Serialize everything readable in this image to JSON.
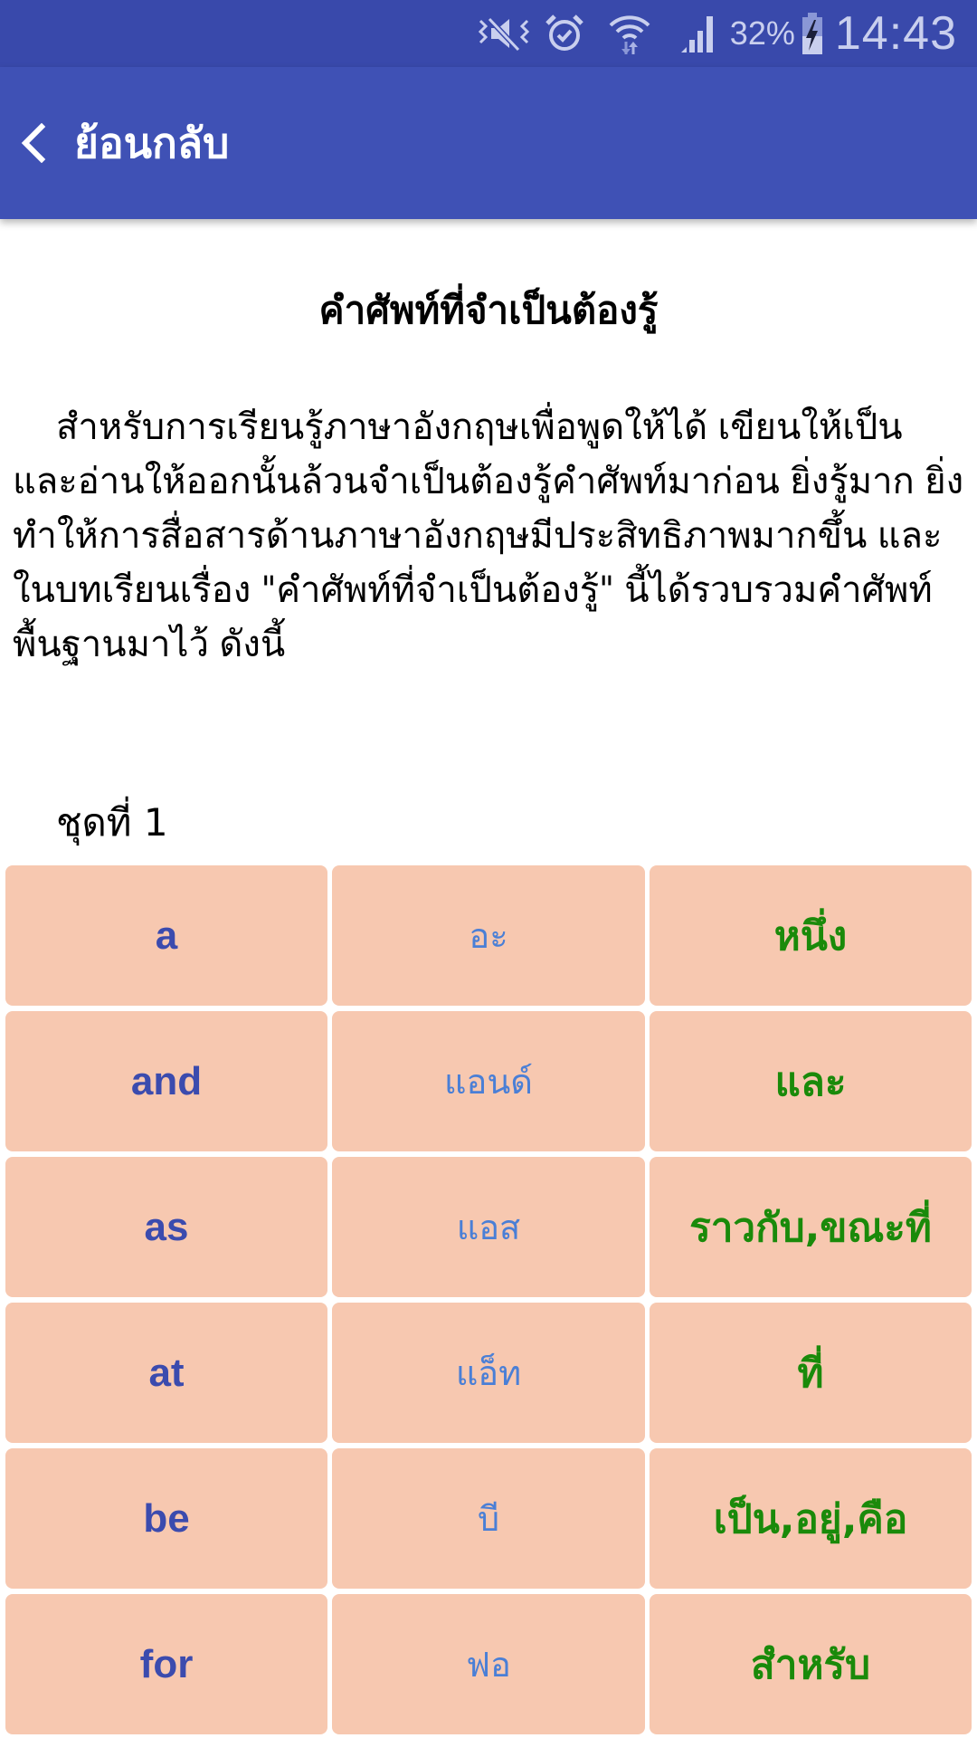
{
  "status_bar": {
    "icons": [
      "mute-vibrate-icon",
      "alarm-icon",
      "wifi-icon",
      "signal-icon",
      "battery-charging-icon"
    ],
    "battery_percent": "32%",
    "time": "14:43"
  },
  "app_bar": {
    "back_label": "ย้อนกลับ"
  },
  "colors": {
    "status_bar": "#3949AB",
    "app_bar": "#3F51B5",
    "cell_bg": "#F7C8B0",
    "english_text": "#3B4BAE",
    "pronunciation_text": "#4A7FD6",
    "thai_meaning_text": "#1A8A0A"
  },
  "main": {
    "title": "คำศัพท์ที่จำเป็นต้องรู้",
    "intro": "สำหรับการเรียนรู้ภาษาอังกฤษเพื่อพูดให้ได้ เขียนให้เป็น และอ่านให้ออกนั้นล้วนจำเป็นต้องรู้คำศัพท์มาก่อน ยิ่งรู้มาก ยิ่งทำให้การสื่อสารด้านภาษาอังกฤษมีประสิทธิภาพมากขึ้น และในบทเรียนเรื่อง \"คำศัพท์ที่จำเป็นต้องรู้\" นี้ได้รวบรวมคำศัพท์พื้นฐานมาไว้ ดังนี้",
    "set_label": "ชุดที่ 1",
    "vocab": [
      {
        "english": "a",
        "pronunciation": "อะ",
        "meaning": "หนึ่ง"
      },
      {
        "english": "and",
        "pronunciation": "แอนด์",
        "meaning": "และ"
      },
      {
        "english": "as",
        "pronunciation": "แอส",
        "meaning": "ราวกับ,ขณะที่"
      },
      {
        "english": "at",
        "pronunciation": "แอ็ท",
        "meaning": "ที่"
      },
      {
        "english": "be",
        "pronunciation": "บี",
        "meaning": "เป็น,อยู่,คือ"
      },
      {
        "english": "for",
        "pronunciation": "ฟอ",
        "meaning": "สำหรับ"
      }
    ]
  }
}
